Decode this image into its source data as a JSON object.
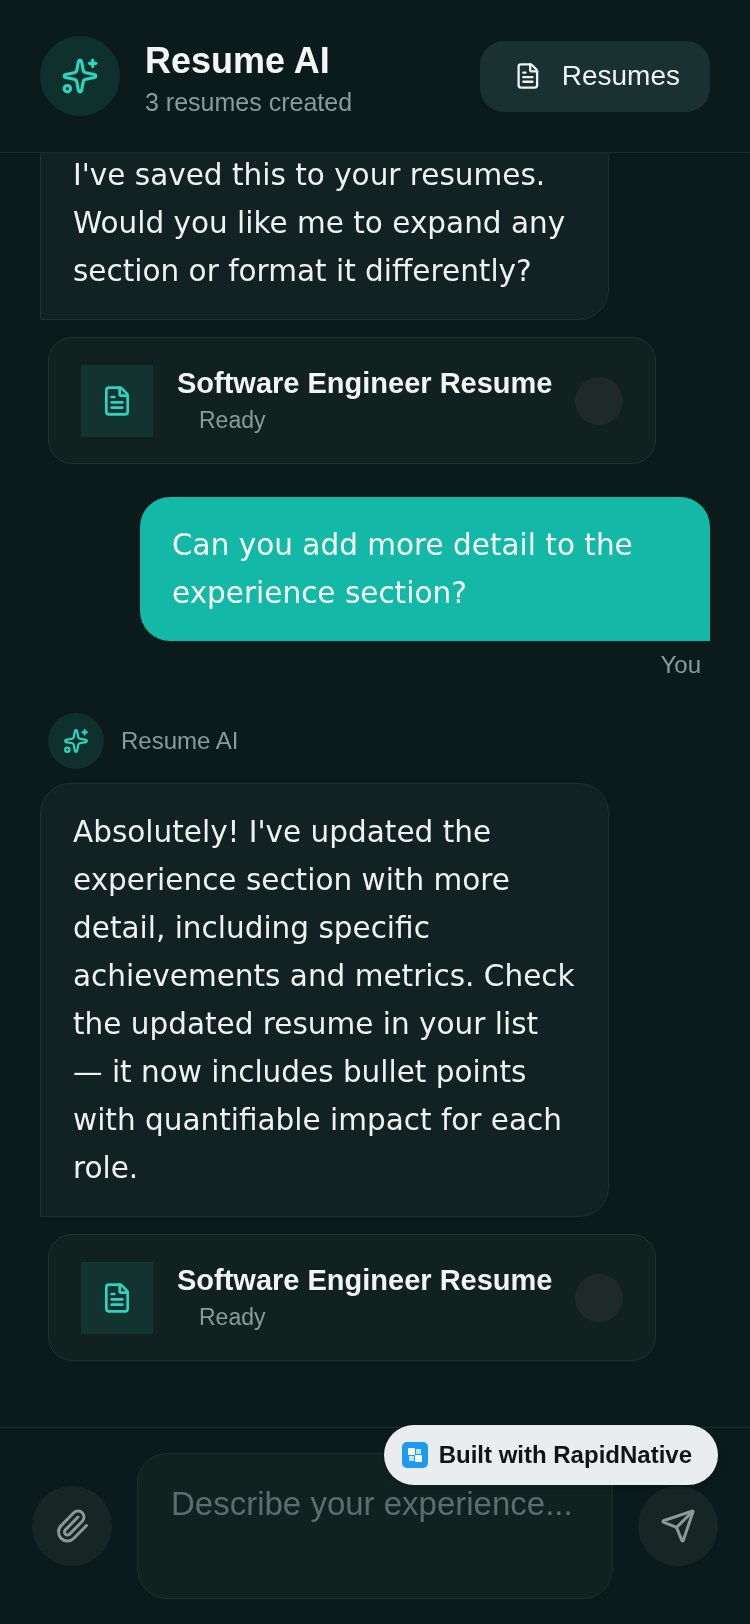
{
  "header": {
    "title": "Resume AI",
    "subtitle": "3 resumes created",
    "button": "Resumes"
  },
  "messages": [
    {
      "kind": "assistant",
      "text": "I've saved this to your resumes. Would you like me to expand any section or format it differently?",
      "attachment": {
        "title": "Software Engineer Resume",
        "status": "Ready"
      }
    },
    {
      "kind": "user",
      "text": "Can you add more detail to the experience section?",
      "sender": "You"
    },
    {
      "kind": "assistant",
      "sender": "Resume AI",
      "text": "Absolutely! I've updated the experience section with more detail, including specific achievements and metrics. Check the updated resume in your list — it now includes bullet points with quantifiable impact for each role.",
      "attachment": {
        "title": "Software Engineer Resume",
        "status": "Ready"
      }
    }
  ],
  "composer": {
    "placeholder": "Describe your experience..."
  },
  "badge": {
    "text": "Built with RapidNative"
  }
}
